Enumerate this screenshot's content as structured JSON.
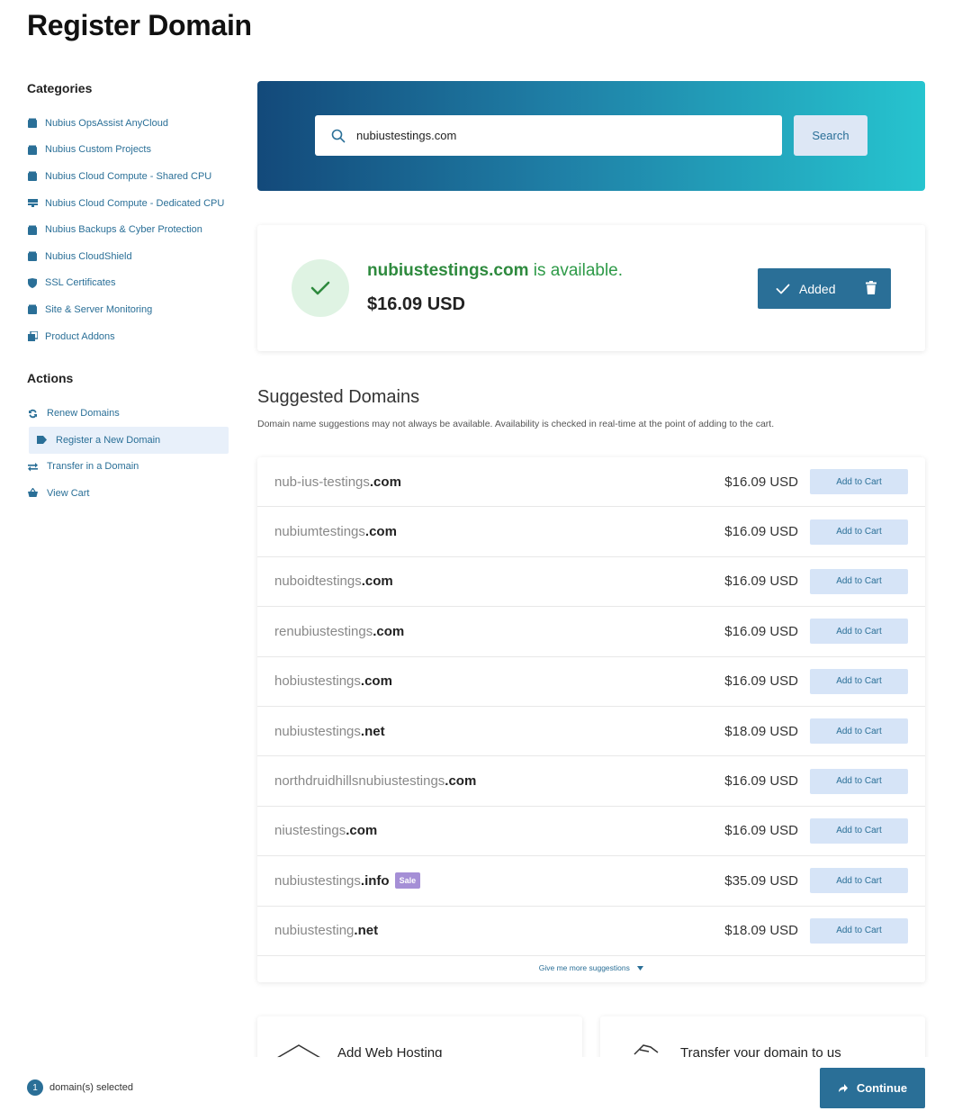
{
  "page": {
    "title": "Register Domain"
  },
  "sidebar": {
    "categories_heading": "Categories",
    "categories": [
      {
        "label": "Nubius OpsAssist AnyCloud",
        "icon": "box-icon"
      },
      {
        "label": "Nubius Custom Projects",
        "icon": "box-icon"
      },
      {
        "label": "Nubius Cloud Compute - Shared CPU",
        "icon": "box-icon"
      },
      {
        "label": "Nubius Cloud Compute - Dedicated CPU",
        "icon": "server-icon"
      },
      {
        "label": "Nubius Backups & Cyber Protection",
        "icon": "box-icon"
      },
      {
        "label": "Nubius CloudShield",
        "icon": "box-icon"
      },
      {
        "label": "SSL Certificates",
        "icon": "shield-icon"
      },
      {
        "label": "Site & Server Monitoring",
        "icon": "box-icon"
      },
      {
        "label": "Product Addons",
        "icon": "cubes-icon"
      }
    ],
    "actions_heading": "Actions",
    "actions": [
      {
        "label": "Renew Domains",
        "icon": "sync-icon"
      },
      {
        "label": "Register a New Domain",
        "icon": "tag-icon",
        "active": true
      },
      {
        "label": "Transfer in a Domain",
        "icon": "exchange-icon"
      },
      {
        "label": "View Cart",
        "icon": "basket-icon"
      }
    ]
  },
  "search": {
    "value": "nubiustestings.com",
    "button_label": "Search"
  },
  "availability": {
    "domain": "nubiustestings.com",
    "status_text": " is available.",
    "price": "$16.09 USD",
    "button_label": "Added"
  },
  "suggested": {
    "title": "Suggested Domains",
    "note": "Domain name suggestions may not always be available. Availability is checked in real-time at the point of adding to the cart.",
    "button_label": "Add to Cart",
    "more_label": "Give me more suggestions",
    "items": [
      {
        "name": "nub-ius-testings",
        "tld": ".com",
        "price": "$16.09 USD"
      },
      {
        "name": "nubiumtestings",
        "tld": ".com",
        "price": "$16.09 USD"
      },
      {
        "name": "nuboidtestings",
        "tld": ".com",
        "price": "$16.09 USD"
      },
      {
        "name": "renubiustestings",
        "tld": ".com",
        "price": "$16.09 USD"
      },
      {
        "name": "hobiustestings",
        "tld": ".com",
        "price": "$16.09 USD"
      },
      {
        "name": "nubiustestings",
        "tld": ".net",
        "price": "$18.09 USD"
      },
      {
        "name": "northdruidhillsnubiustestings",
        "tld": ".com",
        "price": "$16.09 USD"
      },
      {
        "name": "niustestings",
        "tld": ".com",
        "price": "$16.09 USD"
      },
      {
        "name": "nubiustestings",
        "tld": ".info",
        "price": "$35.09 USD",
        "badge": "Sale"
      },
      {
        "name": "nubiustesting",
        "tld": ".net",
        "price": "$18.09 USD"
      }
    ]
  },
  "promos": {
    "hosting_title": "Add Web Hosting",
    "transfer_title": "Transfer your domain to us"
  },
  "bottombar": {
    "count": "1",
    "count_label": "domain(s) selected",
    "continue_label": "Continue"
  },
  "colors": {
    "accent": "#2a6f97",
    "success": "#2e9a48",
    "sale": "#a58fd6"
  }
}
